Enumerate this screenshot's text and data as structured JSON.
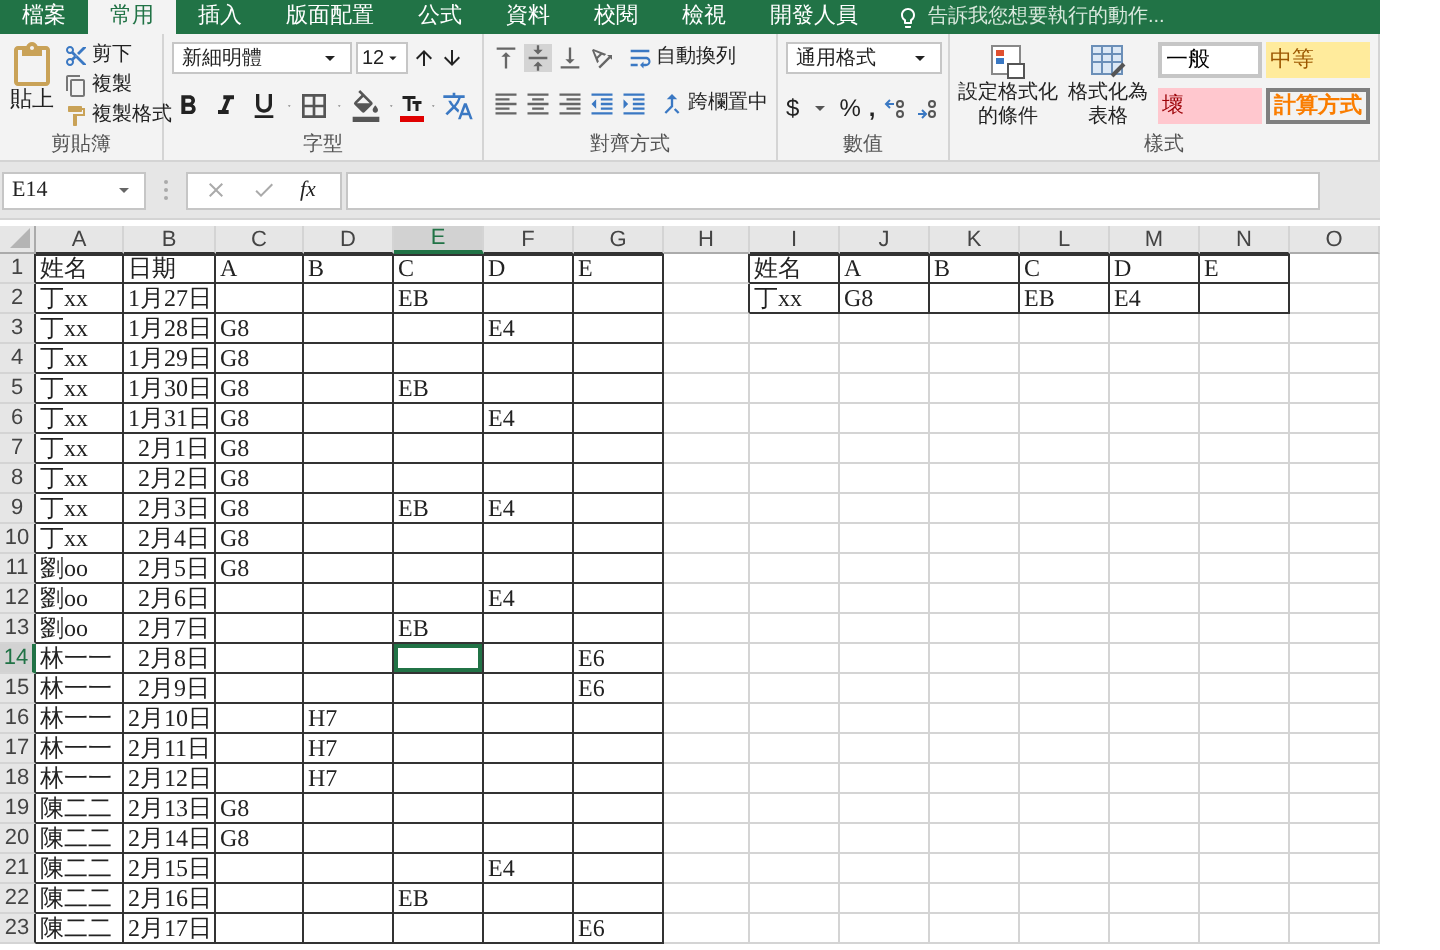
{
  "ribbon": {
    "tabs": [
      {
        "label": "檔案",
        "selected": false
      },
      {
        "label": "常用",
        "selected": true
      },
      {
        "label": "插入",
        "selected": false
      },
      {
        "label": "版面配置",
        "selected": false
      },
      {
        "label": "公式",
        "selected": false
      },
      {
        "label": "資料",
        "selected": false
      },
      {
        "label": "校閱",
        "selected": false
      },
      {
        "label": "檢視",
        "selected": false
      },
      {
        "label": "開發人員",
        "selected": false
      }
    ],
    "tell_me": "告訴我您想要執行的動作...",
    "clipboard": {
      "paste": "貼上",
      "cut": "剪下",
      "copy": "複製",
      "format_painter": "複製格式",
      "label": "剪貼簿"
    },
    "font": {
      "name": "新細明體",
      "size": "12",
      "label": "字型"
    },
    "alignment": {
      "wrap": "自動換列",
      "merge": "跨欄置中",
      "label": "對齊方式"
    },
    "number": {
      "format": "通用格式",
      "currency": "$",
      "percent": "%",
      "comma": ",",
      "label": "數值"
    },
    "styles": {
      "conditional": "設定格式化的條件",
      "table": "格式化為表格",
      "label": "樣式",
      "gallery": [
        {
          "text": "一般",
          "kind": "normal"
        },
        {
          "text": "中等",
          "kind": "neutral"
        },
        {
          "text": "壞",
          "kind": "bad"
        },
        {
          "text": "計算方式",
          "kind": "calculation"
        }
      ]
    }
  },
  "formula_bar": {
    "name_box": "E14",
    "function_label": "fx"
  },
  "sheet": {
    "columns": [
      {
        "label": "A",
        "selected": false
      },
      {
        "label": "B",
        "selected": false
      },
      {
        "label": "C",
        "selected": false
      },
      {
        "label": "D",
        "selected": false
      },
      {
        "label": "E",
        "selected": true
      },
      {
        "label": "F",
        "selected": false
      },
      {
        "label": "G",
        "selected": false
      },
      {
        "label": "H",
        "selected": false
      },
      {
        "label": "I",
        "selected": false
      },
      {
        "label": "J",
        "selected": false
      },
      {
        "label": "K",
        "selected": false
      },
      {
        "label": "L",
        "selected": false
      },
      {
        "label": "M",
        "selected": false
      },
      {
        "label": "N",
        "selected": false
      },
      {
        "label": "O",
        "selected": false
      }
    ],
    "rows": [
      {
        "number": "1",
        "selected": false,
        "cells": [
          "姓名",
          "日期",
          "A",
          "B",
          "C",
          "D",
          "E",
          null,
          "姓名",
          "A",
          "B",
          "C",
          "D",
          "E",
          null
        ],
        "boxed": [
          true,
          true,
          true,
          true,
          true,
          true,
          true,
          false,
          true,
          true,
          true,
          true,
          true,
          true,
          false
        ]
      },
      {
        "number": "2",
        "selected": false,
        "cells": [
          "丁xx",
          "1月27日",
          null,
          null,
          "EB",
          null,
          null,
          null,
          "丁xx",
          "G8",
          null,
          "EB",
          "E4",
          null,
          null
        ],
        "boxed": [
          true,
          true,
          true,
          true,
          true,
          true,
          true,
          false,
          true,
          true,
          true,
          true,
          true,
          true,
          false
        ]
      },
      {
        "number": "3",
        "selected": false,
        "cells": [
          "丁xx",
          "1月28日",
          "G8",
          null,
          null,
          "E4",
          null,
          null,
          null,
          null,
          null,
          null,
          null,
          null,
          null
        ],
        "boxed": [
          true,
          true,
          true,
          true,
          true,
          true,
          true,
          false,
          false,
          false,
          false,
          false,
          false,
          false,
          false
        ]
      },
      {
        "number": "4",
        "selected": false,
        "cells": [
          "丁xx",
          "1月29日",
          "G8",
          null,
          null,
          null,
          null,
          null,
          null,
          null,
          null,
          null,
          null,
          null,
          null
        ],
        "boxed": [
          true,
          true,
          true,
          true,
          true,
          true,
          true,
          false,
          false,
          false,
          false,
          false,
          false,
          false,
          false
        ]
      },
      {
        "number": "5",
        "selected": false,
        "cells": [
          "丁xx",
          "1月30日",
          "G8",
          null,
          "EB",
          null,
          null,
          null,
          null,
          null,
          null,
          null,
          null,
          null,
          null
        ],
        "boxed": [
          true,
          true,
          true,
          true,
          true,
          true,
          true,
          false,
          false,
          false,
          false,
          false,
          false,
          false,
          false
        ]
      },
      {
        "number": "6",
        "selected": false,
        "cells": [
          "丁xx",
          "1月31日",
          "G8",
          null,
          null,
          "E4",
          null,
          null,
          null,
          null,
          null,
          null,
          null,
          null,
          null
        ],
        "boxed": [
          true,
          true,
          true,
          true,
          true,
          true,
          true,
          false,
          false,
          false,
          false,
          false,
          false,
          false,
          false
        ]
      },
      {
        "number": "7",
        "selected": false,
        "cells": [
          "丁xx",
          "2月1日",
          "G8",
          null,
          null,
          null,
          null,
          null,
          null,
          null,
          null,
          null,
          null,
          null,
          null
        ],
        "boxed": [
          true,
          true,
          true,
          true,
          true,
          true,
          true,
          false,
          false,
          false,
          false,
          false,
          false,
          false,
          false
        ]
      },
      {
        "number": "8",
        "selected": false,
        "cells": [
          "丁xx",
          "2月2日",
          "G8",
          null,
          null,
          null,
          null,
          null,
          null,
          null,
          null,
          null,
          null,
          null,
          null
        ],
        "boxed": [
          true,
          true,
          true,
          true,
          true,
          true,
          true,
          false,
          false,
          false,
          false,
          false,
          false,
          false,
          false
        ]
      },
      {
        "number": "9",
        "selected": false,
        "cells": [
          "丁xx",
          "2月3日",
          "G8",
          null,
          "EB",
          "E4",
          null,
          null,
          null,
          null,
          null,
          null,
          null,
          null,
          null
        ],
        "boxed": [
          true,
          true,
          true,
          true,
          true,
          true,
          true,
          false,
          false,
          false,
          false,
          false,
          false,
          false,
          false
        ]
      },
      {
        "number": "10",
        "selected": false,
        "cells": [
          "丁xx",
          "2月4日",
          "G8",
          null,
          null,
          null,
          null,
          null,
          null,
          null,
          null,
          null,
          null,
          null,
          null
        ],
        "boxed": [
          true,
          true,
          true,
          true,
          true,
          true,
          true,
          false,
          false,
          false,
          false,
          false,
          false,
          false,
          false
        ]
      },
      {
        "number": "11",
        "selected": false,
        "cells": [
          "劉oo",
          "2月5日",
          "G8",
          null,
          null,
          null,
          null,
          null,
          null,
          null,
          null,
          null,
          null,
          null,
          null
        ],
        "boxed": [
          true,
          true,
          true,
          true,
          true,
          true,
          true,
          false,
          false,
          false,
          false,
          false,
          false,
          false,
          false
        ]
      },
      {
        "number": "12",
        "selected": false,
        "cells": [
          "劉oo",
          "2月6日",
          null,
          null,
          null,
          "E4",
          null,
          null,
          null,
          null,
          null,
          null,
          null,
          null,
          null
        ],
        "boxed": [
          true,
          true,
          true,
          true,
          true,
          true,
          true,
          false,
          false,
          false,
          false,
          false,
          false,
          false,
          false
        ]
      },
      {
        "number": "13",
        "selected": false,
        "cells": [
          "劉oo",
          "2月7日",
          null,
          null,
          "EB",
          null,
          null,
          null,
          null,
          null,
          null,
          null,
          null,
          null,
          null
        ],
        "boxed": [
          true,
          true,
          true,
          true,
          true,
          true,
          true,
          false,
          false,
          false,
          false,
          false,
          false,
          false,
          false
        ]
      },
      {
        "number": "14",
        "selected": true,
        "cells": [
          "林一一",
          "2月8日",
          null,
          null,
          null,
          null,
          "E6",
          null,
          null,
          null,
          null,
          null,
          null,
          null,
          null
        ],
        "boxed": [
          true,
          true,
          true,
          true,
          true,
          true,
          true,
          false,
          false,
          false,
          false,
          false,
          false,
          false,
          false
        ]
      },
      {
        "number": "15",
        "selected": false,
        "cells": [
          "林一一",
          "2月9日",
          null,
          null,
          null,
          null,
          "E6",
          null,
          null,
          null,
          null,
          null,
          null,
          null,
          null
        ],
        "boxed": [
          true,
          true,
          true,
          true,
          true,
          true,
          true,
          false,
          false,
          false,
          false,
          false,
          false,
          false,
          false
        ]
      },
      {
        "number": "16",
        "selected": false,
        "cells": [
          "林一一",
          "2月10日",
          null,
          "H7",
          null,
          null,
          null,
          null,
          null,
          null,
          null,
          null,
          null,
          null,
          null
        ],
        "boxed": [
          true,
          true,
          true,
          true,
          true,
          true,
          true,
          false,
          false,
          false,
          false,
          false,
          false,
          false,
          false
        ]
      },
      {
        "number": "17",
        "selected": false,
        "cells": [
          "林一一",
          "2月11日",
          null,
          "H7",
          null,
          null,
          null,
          null,
          null,
          null,
          null,
          null,
          null,
          null,
          null
        ],
        "boxed": [
          true,
          true,
          true,
          true,
          true,
          true,
          true,
          false,
          false,
          false,
          false,
          false,
          false,
          false,
          false
        ]
      },
      {
        "number": "18",
        "selected": false,
        "cells": [
          "林一一",
          "2月12日",
          null,
          "H7",
          null,
          null,
          null,
          null,
          null,
          null,
          null,
          null,
          null,
          null,
          null
        ],
        "boxed": [
          true,
          true,
          true,
          true,
          true,
          true,
          true,
          false,
          false,
          false,
          false,
          false,
          false,
          false,
          false
        ]
      },
      {
        "number": "19",
        "selected": false,
        "cells": [
          "陳二二",
          "2月13日",
          "G8",
          null,
          null,
          null,
          null,
          null,
          null,
          null,
          null,
          null,
          null,
          null,
          null
        ],
        "boxed": [
          true,
          true,
          true,
          true,
          true,
          true,
          true,
          false,
          false,
          false,
          false,
          false,
          false,
          false,
          false
        ]
      },
      {
        "number": "20",
        "selected": false,
        "cells": [
          "陳二二",
          "2月14日",
          "G8",
          null,
          null,
          null,
          null,
          null,
          null,
          null,
          null,
          null,
          null,
          null,
          null
        ],
        "boxed": [
          true,
          true,
          true,
          true,
          true,
          true,
          true,
          false,
          false,
          false,
          false,
          false,
          false,
          false,
          false
        ]
      },
      {
        "number": "21",
        "selected": false,
        "cells": [
          "陳二二",
          "2月15日",
          null,
          null,
          null,
          "E4",
          null,
          null,
          null,
          null,
          null,
          null,
          null,
          null,
          null
        ],
        "boxed": [
          true,
          true,
          true,
          true,
          true,
          true,
          true,
          false,
          false,
          false,
          false,
          false,
          false,
          false,
          false
        ]
      },
      {
        "number": "22",
        "selected": false,
        "cells": [
          "陳二二",
          "2月16日",
          null,
          null,
          "EB",
          null,
          null,
          null,
          null,
          null,
          null,
          null,
          null,
          null,
          null
        ],
        "boxed": [
          true,
          true,
          true,
          true,
          true,
          true,
          true,
          false,
          false,
          false,
          false,
          false,
          false,
          false,
          false
        ]
      },
      {
        "number": "23",
        "selected": false,
        "cells": [
          "陳二二",
          "2月17日",
          null,
          null,
          null,
          null,
          "E6",
          null,
          null,
          null,
          null,
          null,
          null,
          null,
          null
        ],
        "boxed": [
          true,
          true,
          true,
          true,
          true,
          true,
          true,
          false,
          false,
          false,
          false,
          false,
          false,
          false,
          false
        ]
      }
    ]
  }
}
